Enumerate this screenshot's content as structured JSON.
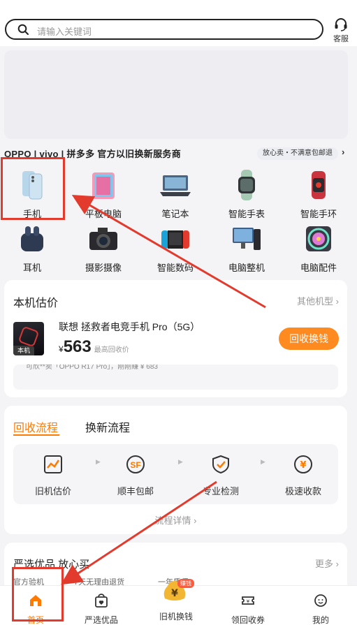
{
  "search": {
    "placeholder": "请输入关键词"
  },
  "service": {
    "label": "客服"
  },
  "partner": {
    "text": "OPPO | vivo | 拼多多 官方以旧换新服务商",
    "badge": "放心卖・不满意包邮退",
    "arrow": "›"
  },
  "categories": [
    {
      "label": "手机",
      "icon": "phone-icon"
    },
    {
      "label": "平板电脑",
      "icon": "tablet-icon"
    },
    {
      "label": "笔记本",
      "icon": "laptop-icon"
    },
    {
      "label": "智能手表",
      "icon": "smartwatch-icon"
    },
    {
      "label": "智能手环",
      "icon": "smartband-icon"
    },
    {
      "label": "耳机",
      "icon": "earphone-icon"
    },
    {
      "label": "摄影摄像",
      "icon": "camera-icon"
    },
    {
      "label": "智能数码",
      "icon": "gamepad-icon"
    },
    {
      "label": "电脑整机",
      "icon": "desktop-icon"
    },
    {
      "label": "电脑配件",
      "icon": "fan-icon"
    }
  ],
  "estimate": {
    "title": "本机估价",
    "more": "其他机型 ›",
    "model": "联想 拯救者电竞手机 Pro（5G）",
    "phone_tag": "本机",
    "currency": "¥",
    "price": "563",
    "price_note": "最高回收价",
    "button": "回收换钱",
    "ticker": "可欣**卖「OPPO R17 Pro」，刚刚赚 ¥ 683"
  },
  "process": {
    "tab_active": "回收流程",
    "tab_other": "换新流程",
    "steps": [
      {
        "label": "旧机估价",
        "icon": "chart-icon"
      },
      {
        "label": "顺丰包邮",
        "icon": "sf-express-icon"
      },
      {
        "label": "专业检测",
        "icon": "shield-check-icon"
      },
      {
        "label": "极速收款",
        "icon": "yen-coin-icon"
      }
    ],
    "detail": "流程详情 ›"
  },
  "picks": {
    "title": "严选优品 放心买",
    "more": "更多 ›",
    "features": [
      "官方验机",
      "7天无理由退货",
      "一年质保"
    ]
  },
  "nav": {
    "items": [
      {
        "label": "首页",
        "icon": "home-icon"
      },
      {
        "label": "严选优品",
        "icon": "bag-heart-icon"
      },
      {
        "label": "旧机换钱",
        "icon": "money-bag-icon"
      },
      {
        "label": "领回收券",
        "icon": "coupon-icon"
      },
      {
        "label": "我的",
        "icon": "profile-icon"
      }
    ],
    "coin_tag": "赚钱"
  },
  "colors": {
    "accent": "#ff7a00",
    "button": "#ff8a1f",
    "annotation": "#e23b2e"
  }
}
